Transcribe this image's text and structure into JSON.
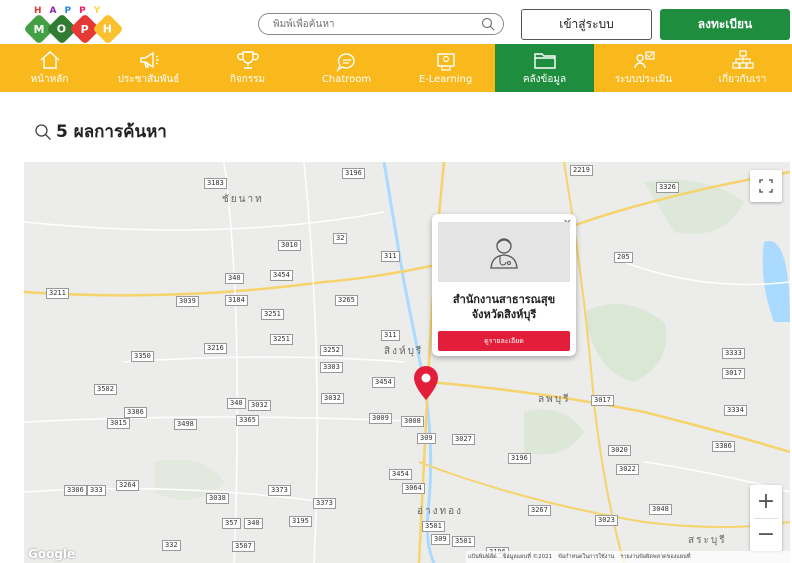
{
  "header": {
    "logo_letters": [
      "H",
      "A",
      "P",
      "P",
      "Y"
    ],
    "logo_word": [
      "M",
      "O",
      "P",
      "H"
    ],
    "search_placeholder": "พิมพ์เพื่อค้นหา",
    "login_label": "เข้าสู่ระบบ",
    "register_label": "ลงทะเบียน"
  },
  "nav": {
    "items": [
      {
        "label": "หน้าหลัก",
        "icon": "home-icon"
      },
      {
        "label": "ประชาสัมพันธ์",
        "icon": "megaphone-icon"
      },
      {
        "label": "กิจกรรม",
        "icon": "trophy-icon"
      },
      {
        "label": "Chatroom",
        "icon": "chat-icon"
      },
      {
        "label": "E-Learning",
        "icon": "elearning-icon"
      },
      {
        "label": "คลังข้อมูล",
        "icon": "folder-icon",
        "active": true
      },
      {
        "label": "ระบบประเมิน",
        "icon": "evaluation-icon"
      },
      {
        "label": "เกี่ยวกับเรา",
        "icon": "sitemap-icon"
      }
    ]
  },
  "results": {
    "text": "5 ผลการค้นหา"
  },
  "map": {
    "routes": [
      "3183",
      "3196",
      "2219",
      "3326",
      "3010",
      "32",
      "3454",
      "340",
      "311",
      "205",
      "3211",
      "3039",
      "3184",
      "3265",
      "3251",
      "3350",
      "3216",
      "3251",
      "3252",
      "3303",
      "311",
      "3333",
      "3017",
      "3502",
      "3454",
      "340",
      "3032",
      "3032",
      "3009",
      "3008",
      "3017",
      "3334",
      "3386",
      "3015",
      "3498",
      "3365",
      "309",
      "3027",
      "3196",
      "3020",
      "3386",
      "3454",
      "3022",
      "3064",
      "3306",
      "333",
      "3264",
      "3038",
      "3373",
      "3373",
      "357",
      "340",
      "3195",
      "3267",
      "3023",
      "3048",
      "3501",
      "309",
      "3501",
      "3507",
      "332",
      "3196"
    ],
    "places": [
      "ชัยนาท",
      "สิงห์บุรี",
      "ลพบุรี",
      "อ่างทอง",
      "สระบุรี"
    ],
    "zoom_in": "+",
    "zoom_out": "−",
    "google": "Google",
    "attribution": [
      "แป้นพิมพ์ลัด",
      "ข้อมูลแผนที่ ©2021",
      "ข้อกำหนดในการใช้งาน",
      "รายงานข้อผิดพลาดของแผนที่"
    ]
  },
  "popup": {
    "close": "×",
    "title_line1": "สำนักงานสาธารณสุข",
    "title_line2": "จังหวัดสิงห์บุรี",
    "button": "ดูรายละเอียด"
  },
  "colors": {
    "nav_bg": "#f9b81b",
    "active_green": "#1e8e3e",
    "pin_red": "#e31e3b"
  }
}
